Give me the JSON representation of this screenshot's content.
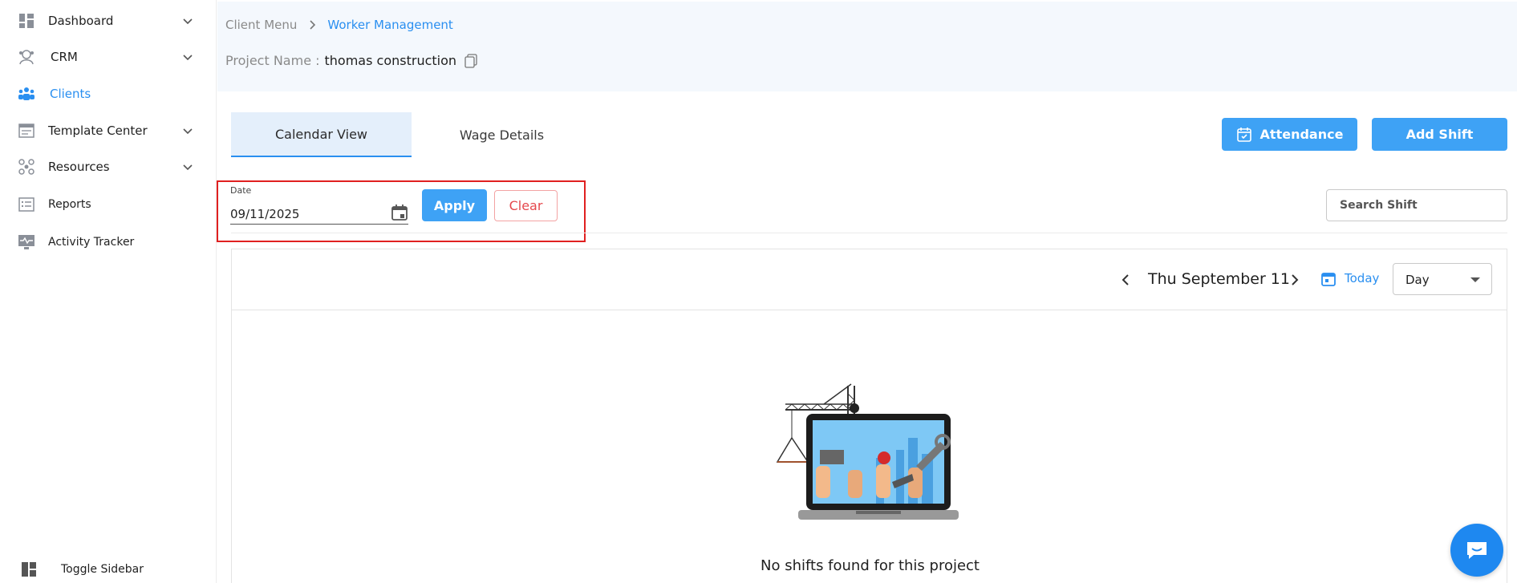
{
  "sidebar": {
    "items": [
      {
        "label": "Dashboard",
        "icon": "dashboard-icon",
        "has_chevron": true
      },
      {
        "label": "CRM",
        "icon": "crm-icon",
        "has_chevron": true
      },
      {
        "label": "Clients",
        "icon": "clients-icon",
        "has_chevron": false,
        "active": true
      },
      {
        "label": "Template Center",
        "icon": "template-icon",
        "has_chevron": true
      },
      {
        "label": "Resources",
        "icon": "resources-icon",
        "has_chevron": true
      },
      {
        "label": "Reports",
        "icon": "reports-icon",
        "has_chevron": false
      },
      {
        "label": "Activity Tracker",
        "icon": "activity-icon",
        "has_chevron": false
      }
    ],
    "toggle_label": "Toggle Sidebar"
  },
  "breadcrumb": {
    "parent": "Client Menu",
    "current": "Worker Management"
  },
  "project": {
    "key": "Project Name :",
    "value": "thomas construction"
  },
  "tabs": [
    {
      "label": "Calendar View",
      "active": true
    },
    {
      "label": "Wage Details",
      "active": false
    }
  ],
  "actions": {
    "attendance_label": "Attendance",
    "add_shift_label": "Add Shift"
  },
  "filter": {
    "date_label": "Date",
    "date_value": "09/11/2025",
    "apply_label": "Apply",
    "clear_label": "Clear"
  },
  "search": {
    "placeholder": "Search Shift"
  },
  "calendar": {
    "current_date": "Thu September 11",
    "today_label": "Today",
    "view_value": "Day",
    "empty_message": "No shifts found for this project"
  },
  "colors": {
    "accent": "#2a8ff0",
    "primary_button": "#3ea2f5",
    "highlight_border": "#e02020",
    "clear_text": "#e5484d",
    "header_band": "#f4f8fd"
  }
}
